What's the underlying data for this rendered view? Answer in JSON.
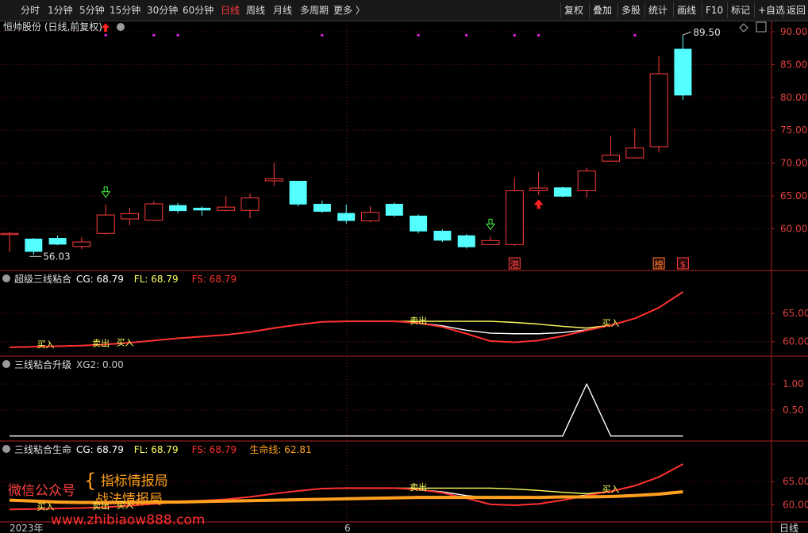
{
  "toolbar": {
    "periods": [
      "分时",
      "1分钟",
      "5分钟",
      "15分钟",
      "30分钟",
      "60分钟",
      "日线",
      "周线",
      "月线",
      "多周期",
      "更多 〉"
    ],
    "active": "日线",
    "right": [
      "复权",
      "叠加",
      "多股",
      "统计",
      "画线",
      "F10",
      "标记",
      "+自选",
      "返回"
    ]
  },
  "main": {
    "title": "恒帅股份 (日线,前复权)",
    "icons": [
      "chevron-down-icon",
      "red-up-arrow-icon"
    ],
    "price_ticks": [
      "90.00",
      "85.00",
      "80.00",
      "75.00",
      "70.00",
      "65.00",
      "60.00"
    ],
    "max_label": "89.50",
    "min_label": "56.03",
    "badge_labels": [
      "港",
      "榜",
      "$"
    ]
  },
  "chart_data": [
    {
      "type": "candlestick",
      "ylim": [
        54.5,
        90.0
      ],
      "candles": [
        [
          59.3,
          59.3,
          56.5,
          59.5
        ],
        [
          58.5,
          56.5,
          56.03,
          58.6
        ],
        [
          58.6,
          57.6,
          57.5,
          59.0
        ],
        [
          57.3,
          58.0,
          56.9,
          58.7
        ],
        [
          59.3,
          62.1,
          59.1,
          63.7
        ],
        [
          61.5,
          62.3,
          60.5,
          63.2
        ],
        [
          61.3,
          63.8,
          61.2,
          64.2
        ],
        [
          63.6,
          62.7,
          62.4,
          63.9
        ],
        [
          63.2,
          62.8,
          62.0,
          63.4
        ],
        [
          62.8,
          63.3,
          62.6,
          65.0
        ],
        [
          62.8,
          64.7,
          61.6,
          65.4
        ],
        [
          67.3,
          67.6,
          66.5,
          70.0
        ],
        [
          67.3,
          63.7,
          63.4,
          67.3
        ],
        [
          63.8,
          62.6,
          62.4,
          64.3
        ],
        [
          62.4,
          61.2,
          60.8,
          63.7
        ],
        [
          61.2,
          62.5,
          61.0,
          63.4
        ],
        [
          63.8,
          62.0,
          61.8,
          64.0
        ],
        [
          62.0,
          59.6,
          59.3,
          62.2
        ],
        [
          59.7,
          58.2,
          58.0,
          59.9
        ],
        [
          59.0,
          57.2,
          57.0,
          59.2
        ],
        [
          57.6,
          58.2,
          57.5,
          58.8
        ],
        [
          57.6,
          65.8,
          57.4,
          67.8
        ],
        [
          65.8,
          66.2,
          65.2,
          68.7
        ],
        [
          66.3,
          64.9,
          64.8,
          66.4
        ],
        [
          65.8,
          68.8,
          64.7,
          69.3
        ],
        [
          70.3,
          71.2,
          70.2,
          74.1
        ],
        [
          70.8,
          72.3,
          70.7,
          75.3
        ],
        [
          72.5,
          83.6,
          71.6,
          86.3
        ],
        [
          87.4,
          80.3,
          79.6,
          89.5
        ]
      ],
      "signal_markers": [
        {
          "index": 4,
          "kind": "green-down-arrow"
        },
        {
          "index": 20,
          "kind": "green-down-arrow"
        },
        {
          "index": 22,
          "kind": "red-up-arrow"
        }
      ]
    },
    {
      "type": "line",
      "title": "超级三线粘合",
      "legend": [
        {
          "label": "CG: 68.79",
          "color": "#ffffff"
        },
        {
          "label": "FL: 68.79",
          "color": "#ffff60"
        },
        {
          "label": "FS: 68.79",
          "color": "#ff3030"
        }
      ],
      "ylim": [
        58.0,
        69.5
      ],
      "y_ticks": [
        "65.00",
        "60.00"
      ],
      "x": [
        0,
        1,
        2,
        3,
        4,
        5,
        6,
        7,
        8,
        9,
        10,
        11,
        12,
        13,
        14,
        15,
        16,
        17,
        18,
        19,
        20,
        21,
        22,
        23,
        24,
        25,
        26,
        27,
        28
      ],
      "series": [
        {
          "name": "CG",
          "color": "#ffffff",
          "values": [
            59.0,
            59.1,
            59.2,
            59.3,
            59.5,
            59.8,
            60.2,
            60.6,
            60.9,
            61.2,
            61.7,
            62.4,
            63.0,
            63.5,
            63.6,
            63.6,
            63.6,
            63.3,
            62.8,
            62.0,
            61.5,
            61.4,
            61.4,
            61.6,
            62.1,
            62.9,
            64.1,
            66.0,
            68.79
          ]
        },
        {
          "name": "FL",
          "color": "#ffff60",
          "values": [
            59.0,
            59.1,
            59.2,
            59.3,
            59.5,
            59.8,
            60.2,
            60.6,
            60.9,
            61.2,
            61.7,
            62.4,
            63.0,
            63.5,
            63.6,
            63.6,
            63.6,
            63.6,
            63.6,
            63.6,
            63.6,
            63.4,
            63.1,
            62.7,
            62.4,
            62.9,
            64.1,
            66.0,
            68.79
          ]
        },
        {
          "name": "FS",
          "color": "#ff3030",
          "values": [
            59.0,
            59.1,
            59.2,
            59.3,
            59.5,
            59.8,
            60.2,
            60.6,
            60.9,
            61.2,
            61.7,
            62.4,
            63.0,
            63.5,
            63.6,
            63.6,
            63.6,
            63.3,
            62.6,
            61.4,
            60.1,
            59.9,
            60.2,
            61.0,
            62.0,
            62.9,
            64.1,
            66.0,
            68.79
          ]
        }
      ],
      "signals": [
        {
          "label": "买入",
          "index": 1.5
        },
        {
          "label": "卖出",
          "index": 3.8
        },
        {
          "label": "买入",
          "index": 4.8
        },
        {
          "label": "卖出",
          "index": 17.0
        },
        {
          "label": "买入",
          "index": 25.0
        }
      ]
    },
    {
      "type": "line",
      "title": "三线粘合升级",
      "legend": [
        {
          "label": "XG2: 0.00",
          "color": "#c8c8c8"
        }
      ],
      "ylim": [
        -0.05,
        1.2
      ],
      "y_ticks": [
        "1.00",
        "0.50"
      ],
      "x": [
        0,
        1,
        2,
        3,
        4,
        5,
        6,
        7,
        8,
        9,
        10,
        11,
        12,
        13,
        14,
        15,
        16,
        17,
        18,
        19,
        20,
        21,
        22,
        23,
        24,
        25,
        26,
        27,
        28
      ],
      "series": [
        {
          "name": "XG2",
          "color": "#ffffff",
          "values": [
            0,
            0,
            0,
            0,
            0,
            0,
            0,
            0,
            0,
            0,
            0,
            0,
            0,
            0,
            0,
            0,
            0,
            0,
            0,
            0,
            0,
            0,
            0,
            0,
            1,
            0,
            0,
            0,
            0
          ]
        }
      ]
    },
    {
      "type": "line",
      "title": "三线粘合生命",
      "legend": [
        {
          "label": "CG: 68.79",
          "color": "#ffffff"
        },
        {
          "label": "FL: 68.79",
          "color": "#ffff60"
        },
        {
          "label": "FS: 68.79",
          "color": "#ff3030"
        },
        {
          "label": "生命线: 62.81",
          "color": "#ffa020"
        }
      ],
      "ylim": [
        57.0,
        70.0
      ],
      "y_ticks": [
        "65.00",
        "60.00"
      ],
      "x": [
        0,
        1,
        2,
        3,
        4,
        5,
        6,
        7,
        8,
        9,
        10,
        11,
        12,
        13,
        14,
        15,
        16,
        17,
        18,
        19,
        20,
        21,
        22,
        23,
        24,
        25,
        26,
        27,
        28
      ],
      "series": [
        {
          "name": "CG",
          "color": "#ffffff",
          "values": [
            59.0,
            59.1,
            59.2,
            59.3,
            59.5,
            59.8,
            60.2,
            60.6,
            60.9,
            61.2,
            61.7,
            62.4,
            63.0,
            63.5,
            63.6,
            63.6,
            63.6,
            63.3,
            62.8,
            62.0,
            61.5,
            61.4,
            61.4,
            61.6,
            62.1,
            62.9,
            64.1,
            66.0,
            68.79
          ]
        },
        {
          "name": "FL",
          "color": "#ffff60",
          "values": [
            59.0,
            59.1,
            59.2,
            59.3,
            59.5,
            59.8,
            60.2,
            60.6,
            60.9,
            61.2,
            61.7,
            62.4,
            63.0,
            63.5,
            63.6,
            63.6,
            63.6,
            63.6,
            63.6,
            63.6,
            63.6,
            63.4,
            63.1,
            62.7,
            62.4,
            62.9,
            64.1,
            66.0,
            68.79
          ]
        },
        {
          "name": "FS",
          "color": "#ff3030",
          "values": [
            59.0,
            59.1,
            59.2,
            59.3,
            59.5,
            59.8,
            60.2,
            60.6,
            60.9,
            61.2,
            61.7,
            62.4,
            63.0,
            63.5,
            63.6,
            63.6,
            63.6,
            63.3,
            62.6,
            61.4,
            60.1,
            59.9,
            60.2,
            61.0,
            62.0,
            62.9,
            64.1,
            66.0,
            68.79
          ]
        },
        {
          "name": "生命线",
          "color": "#ffa020",
          "values": [
            61.0,
            60.8,
            60.6,
            60.5,
            60.5,
            60.5,
            60.6,
            60.6,
            60.7,
            60.8,
            60.9,
            61.0,
            61.1,
            61.2,
            61.3,
            61.4,
            61.5,
            61.6,
            61.6,
            61.6,
            61.6,
            61.6,
            61.6,
            61.7,
            61.7,
            61.8,
            62.0,
            62.3,
            62.81
          ]
        }
      ],
      "signals": [
        {
          "label": "买入",
          "index": 1.5
        },
        {
          "label": "卖出",
          "index": 3.8
        },
        {
          "label": "买入",
          "index": 4.8
        },
        {
          "label": "卖出",
          "index": 17.0
        },
        {
          "label": "买入",
          "index": 25.0
        }
      ]
    }
  ],
  "xaxis": {
    "labels": [
      "2023年",
      "6"
    ],
    "period_label": "日线"
  },
  "watermark": {
    "line1_left": "微信公众号",
    "line1_right": "指标情报局",
    "line2_right": "战法情报局",
    "url": "www.zhibiaow888.com"
  }
}
